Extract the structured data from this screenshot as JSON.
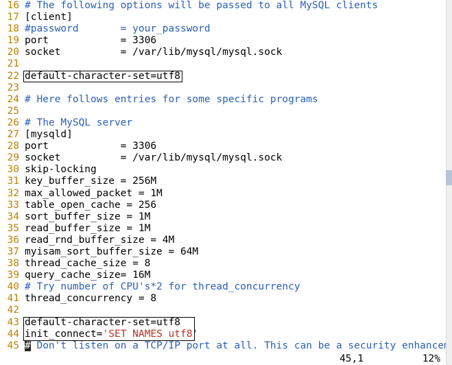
{
  "editor": {
    "first_line_no": 16,
    "lines": [
      {
        "n": 16,
        "segs": [
          {
            "t": "# The following options will be passed to all MySQL clients",
            "c": "comment"
          }
        ]
      },
      {
        "n": 17,
        "segs": [
          {
            "t": "[client]",
            "c": ""
          }
        ]
      },
      {
        "n": 18,
        "segs": [
          {
            "t": "#password       = your_password",
            "c": "comment"
          }
        ]
      },
      {
        "n": 19,
        "segs": [
          {
            "t": "port            = 3306",
            "c": ""
          }
        ]
      },
      {
        "n": 20,
        "segs": [
          {
            "t": "socket          = /var/lib/mysql/mysql.sock",
            "c": ""
          }
        ]
      },
      {
        "n": 21,
        "segs": [
          {
            "t": "",
            "c": ""
          }
        ]
      },
      {
        "n": 22,
        "segs": [
          {
            "t": "default-character-set=utf8",
            "c": ""
          }
        ]
      },
      {
        "n": 23,
        "segs": [
          {
            "t": "",
            "c": ""
          }
        ]
      },
      {
        "n": 24,
        "segs": [
          {
            "t": "# Here follows entries for some specific programs",
            "c": "comment"
          }
        ]
      },
      {
        "n": 25,
        "segs": [
          {
            "t": "",
            "c": ""
          }
        ]
      },
      {
        "n": 26,
        "segs": [
          {
            "t": "# The MySQL server",
            "c": "comment"
          }
        ]
      },
      {
        "n": 27,
        "segs": [
          {
            "t": "[mysqld]",
            "c": ""
          }
        ]
      },
      {
        "n": 28,
        "segs": [
          {
            "t": "port            = 3306",
            "c": ""
          }
        ]
      },
      {
        "n": 29,
        "segs": [
          {
            "t": "socket          = /var/lib/mysql/mysql.sock",
            "c": ""
          }
        ]
      },
      {
        "n": 30,
        "segs": [
          {
            "t": "skip-locking",
            "c": ""
          }
        ]
      },
      {
        "n": 31,
        "segs": [
          {
            "t": "key_buffer_size = 256M",
            "c": ""
          }
        ]
      },
      {
        "n": 32,
        "segs": [
          {
            "t": "max_allowed_packet = 1M",
            "c": ""
          }
        ]
      },
      {
        "n": 33,
        "segs": [
          {
            "t": "table_open_cache = 256",
            "c": ""
          }
        ]
      },
      {
        "n": 34,
        "segs": [
          {
            "t": "sort_buffer_size = 1M",
            "c": ""
          }
        ]
      },
      {
        "n": 35,
        "segs": [
          {
            "t": "read_buffer_size = 1M",
            "c": ""
          }
        ]
      },
      {
        "n": 36,
        "segs": [
          {
            "t": "read_rnd_buffer_size = 4M",
            "c": ""
          }
        ]
      },
      {
        "n": 37,
        "segs": [
          {
            "t": "myisam_sort_buffer_size = 64M",
            "c": ""
          }
        ]
      },
      {
        "n": 38,
        "segs": [
          {
            "t": "thread_cache_size = 8",
            "c": ""
          }
        ]
      },
      {
        "n": 39,
        "segs": [
          {
            "t": "query_cache_size= 16M",
            "c": ""
          }
        ]
      },
      {
        "n": 40,
        "segs": [
          {
            "t": "# Try number of CPU's*2 for thread_concurrency",
            "c": "comment"
          }
        ]
      },
      {
        "n": 41,
        "segs": [
          {
            "t": "thread_concurrency = 8",
            "c": ""
          }
        ]
      },
      {
        "n": 42,
        "segs": [
          {
            "t": "",
            "c": ""
          }
        ]
      },
      {
        "n": 43,
        "segs": [
          {
            "t": "default-character-set=utf8",
            "c": ""
          }
        ]
      },
      {
        "n": 44,
        "segs": [
          {
            "t": "init_connect=",
            "c": ""
          },
          {
            "t": "'SET NAMES utf8'",
            "c": "str"
          }
        ]
      },
      {
        "n": 45,
        "segs": [
          {
            "t": "#",
            "c": "cursor"
          },
          {
            "t": " Don't listen on a TCP/IP port at all. This can be a security enhancement,",
            "c": "comment"
          }
        ]
      }
    ]
  },
  "highlight_boxes": {
    "box1_line": 22,
    "box2_lines": [
      43,
      44
    ]
  },
  "status": {
    "position": "45,1",
    "percent": "12%"
  }
}
